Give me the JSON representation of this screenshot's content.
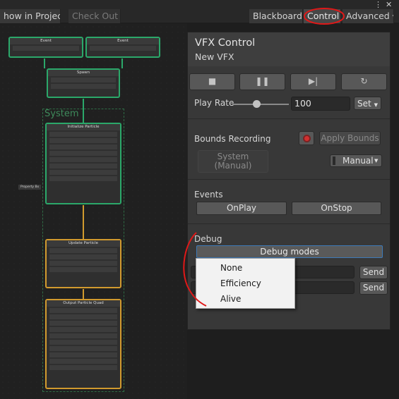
{
  "toolbar": {
    "show_in_project": "how in Project",
    "check_out": "Check Out",
    "blackboard": "Blackboard",
    "control": "Control",
    "advanced": "Advanced",
    "more_icon": "more-vertical-icon",
    "close_icon": "close-icon"
  },
  "graph": {
    "system_label": "System",
    "node_spawn": "Spawn",
    "node_init": "Initialize Particle",
    "node_update": "Update Particle",
    "node_output": "Output Particle Quad",
    "node_event_left": "Event",
    "node_event_right": "Event",
    "property_label": "Property Bx"
  },
  "panel": {
    "title": "VFX Control",
    "subtitle": "New VFX",
    "controls": [
      "stop-icon",
      "pause-icon",
      "step-icon",
      "restart-icon"
    ],
    "play_rate_label": "Play Rate",
    "play_rate_value": "100",
    "play_rate_fraction": 0.42,
    "set_label": "Set",
    "bounds_label": "Bounds Recording",
    "apply_bounds": "Apply Bounds",
    "system_line1": "System",
    "system_line2": "(Manual)",
    "manual_label": "Manual",
    "events_label": "Events",
    "onplay": "OnPlay",
    "onstop": "OnStop",
    "debug_label": "Debug",
    "debug_modes": "Debug modes",
    "send1": "Send",
    "send2": "Send"
  },
  "popup": {
    "items": [
      "None",
      "Efficiency",
      "Alive"
    ]
  },
  "colors": {
    "accent_green": "#2ba86a",
    "accent_orange": "#d19a2e",
    "annotation_red": "#e01818"
  }
}
